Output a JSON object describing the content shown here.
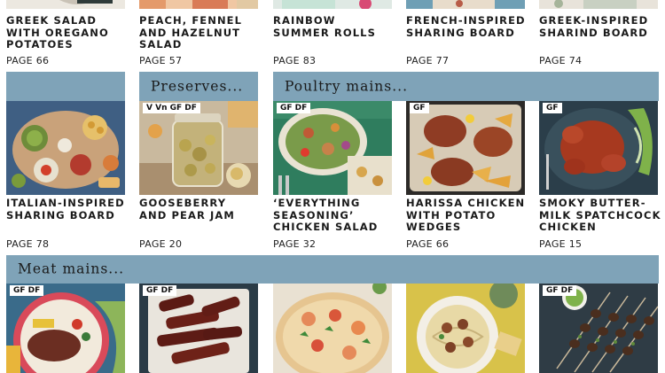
{
  "top_row": [
    {
      "title": "GREEK SALAD\nWITH OREGANO\nPOTATOES",
      "page": "PAGE 66"
    },
    {
      "title": "PEACH, FENNEL\nAND HAZELNUT\nSALAD",
      "page": "PAGE 57"
    },
    {
      "title": "RAINBOW\nSUMMER ROLLS",
      "page": "PAGE 83"
    },
    {
      "title": "FRENCH-INSPIRED\nSHARING BOARD",
      "page": "PAGE 77"
    },
    {
      "title": "GREEK-INSPIRED\nSHARIND BOARD",
      "page": "PAGE 74"
    }
  ],
  "sections": {
    "preserves": "Preserves...",
    "poultry": "Poultry mains...",
    "meat": "Meat mains..."
  },
  "middle_row": [
    {
      "tag": "",
      "title": "ITALIAN-INSPIRED\nSHARING BOARD",
      "page": "PAGE 78"
    },
    {
      "tag": "V Vn GF DF",
      "title": "GOOSEBERRY\nAND PEAR JAM",
      "page": "PAGE 20"
    },
    {
      "tag": "GF DF",
      "title": "‘EVERYTHING\nSEASONING’\nCHICKEN SALAD",
      "page": "PAGE 32"
    },
    {
      "tag": "GF",
      "title": "HARISSA CHICKEN\nWITH POTATO\nWEDGES",
      "page": "PAGE 66"
    },
    {
      "tag": "GF",
      "title": "SMOKY BUTTER-\nMILK SPATCHCOCK\nCHICKEN",
      "page": "PAGE 15"
    }
  ],
  "bottom_row": [
    {
      "tag": "GF DF"
    },
    {
      "tag": "GF DF"
    },
    {
      "tag": ""
    },
    {
      "tag": ""
    },
    {
      "tag": "GF DF"
    }
  ]
}
